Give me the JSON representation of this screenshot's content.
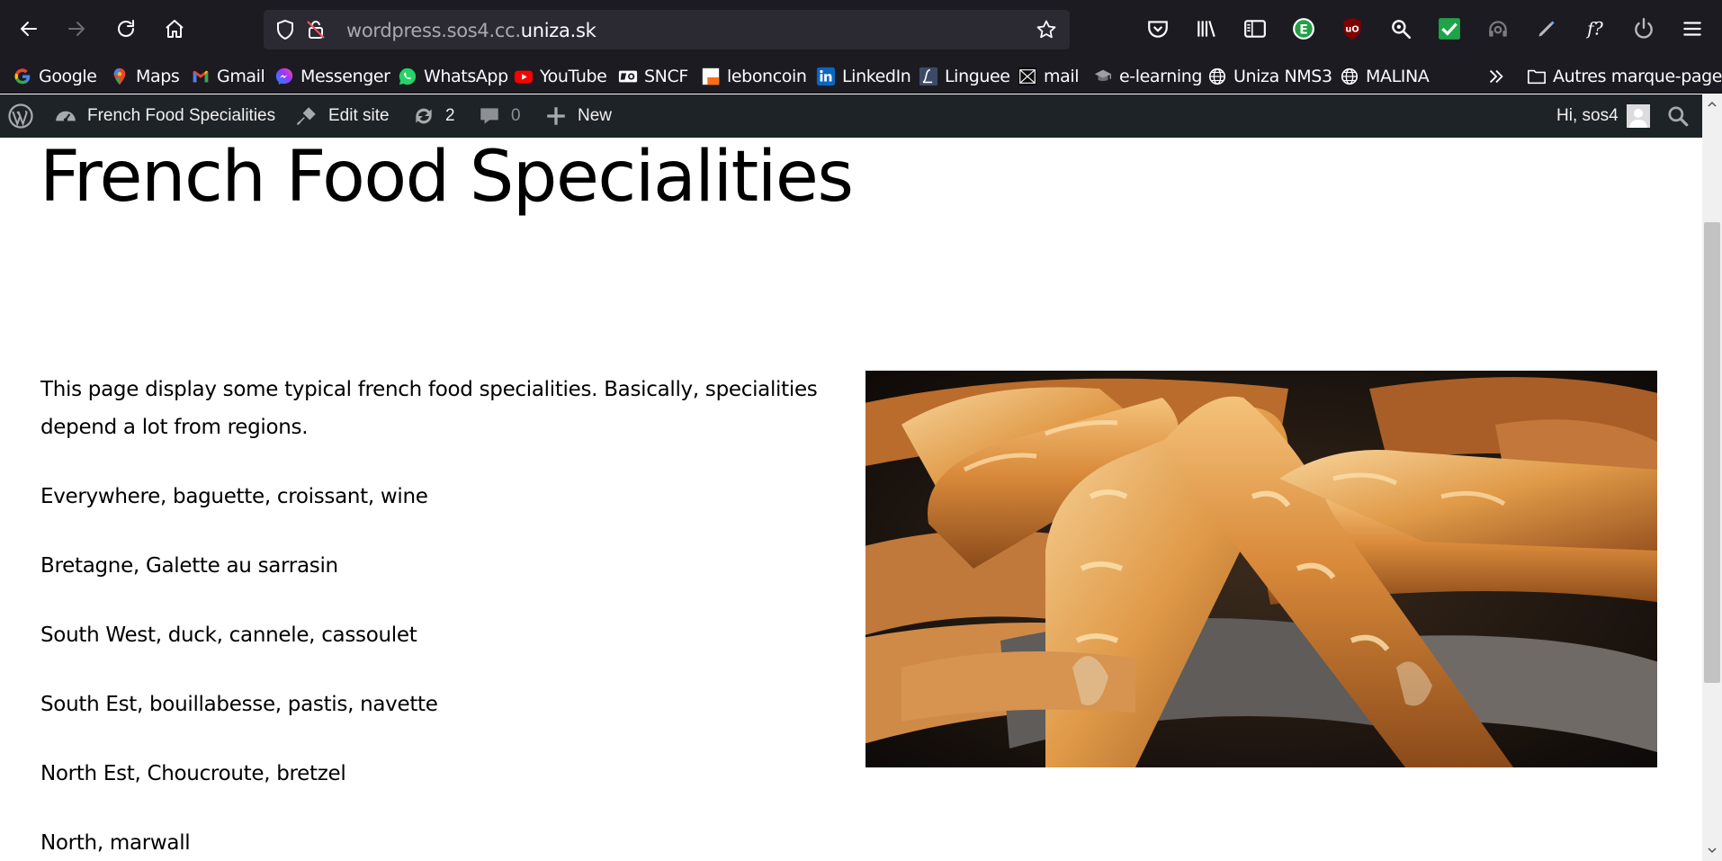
{
  "browser": {
    "url_prefix": "wordpress.sos4.cc.",
    "url_domain": "uniza.sk"
  },
  "bookmarks": [
    {
      "label": "Google",
      "icon": "google-icon"
    },
    {
      "label": "Maps",
      "icon": "maps-icon"
    },
    {
      "label": "Gmail",
      "icon": "gmail-icon"
    },
    {
      "label": "Messenger",
      "icon": "messenger-icon"
    },
    {
      "label": "WhatsApp",
      "icon": "whatsapp-icon"
    },
    {
      "label": "YouTube",
      "icon": "youtube-icon"
    },
    {
      "label": "SNCF",
      "icon": "sncf-icon"
    },
    {
      "label": "leboncoin",
      "icon": "leboncoin-icon"
    },
    {
      "label": "LinkedIn",
      "icon": "linkedin-icon"
    },
    {
      "label": "Linguee",
      "icon": "linguee-icon"
    },
    {
      "label": "mail",
      "icon": "mail-icon"
    },
    {
      "label": "e-learning",
      "icon": "elearning-icon"
    },
    {
      "label": "Uniza NMS3",
      "icon": "globe-icon"
    },
    {
      "label": "MALINA",
      "icon": "globe-icon"
    }
  ],
  "bookmarks_other": "Autres marque-pages",
  "adminbar": {
    "site_name": "French Food Specialities",
    "edit_site": "Edit site",
    "updates_count": "2",
    "comments_count": "0",
    "new_label": "New",
    "greeting": "Hi, sos4"
  },
  "page": {
    "title": "French Food Specialities",
    "paragraphs": [
      "This page display some typical french food specialities. Basically, specialities depend a lot from regions.",
      "Everywhere, baguette, croissant, wine",
      "Bretagne, Galette au sarrasin",
      "South West, duck, cannele, cassoulet",
      "South Est, bouillabesse, pastis, navette",
      "North Est, Choucroute, bretzel",
      "North, marwall"
    ]
  },
  "colors": {
    "toolbar_bg": "#1c1b22",
    "urlbar_bg": "#2b2a33",
    "adminbar_bg": "#1d2327",
    "text": "#000000"
  }
}
